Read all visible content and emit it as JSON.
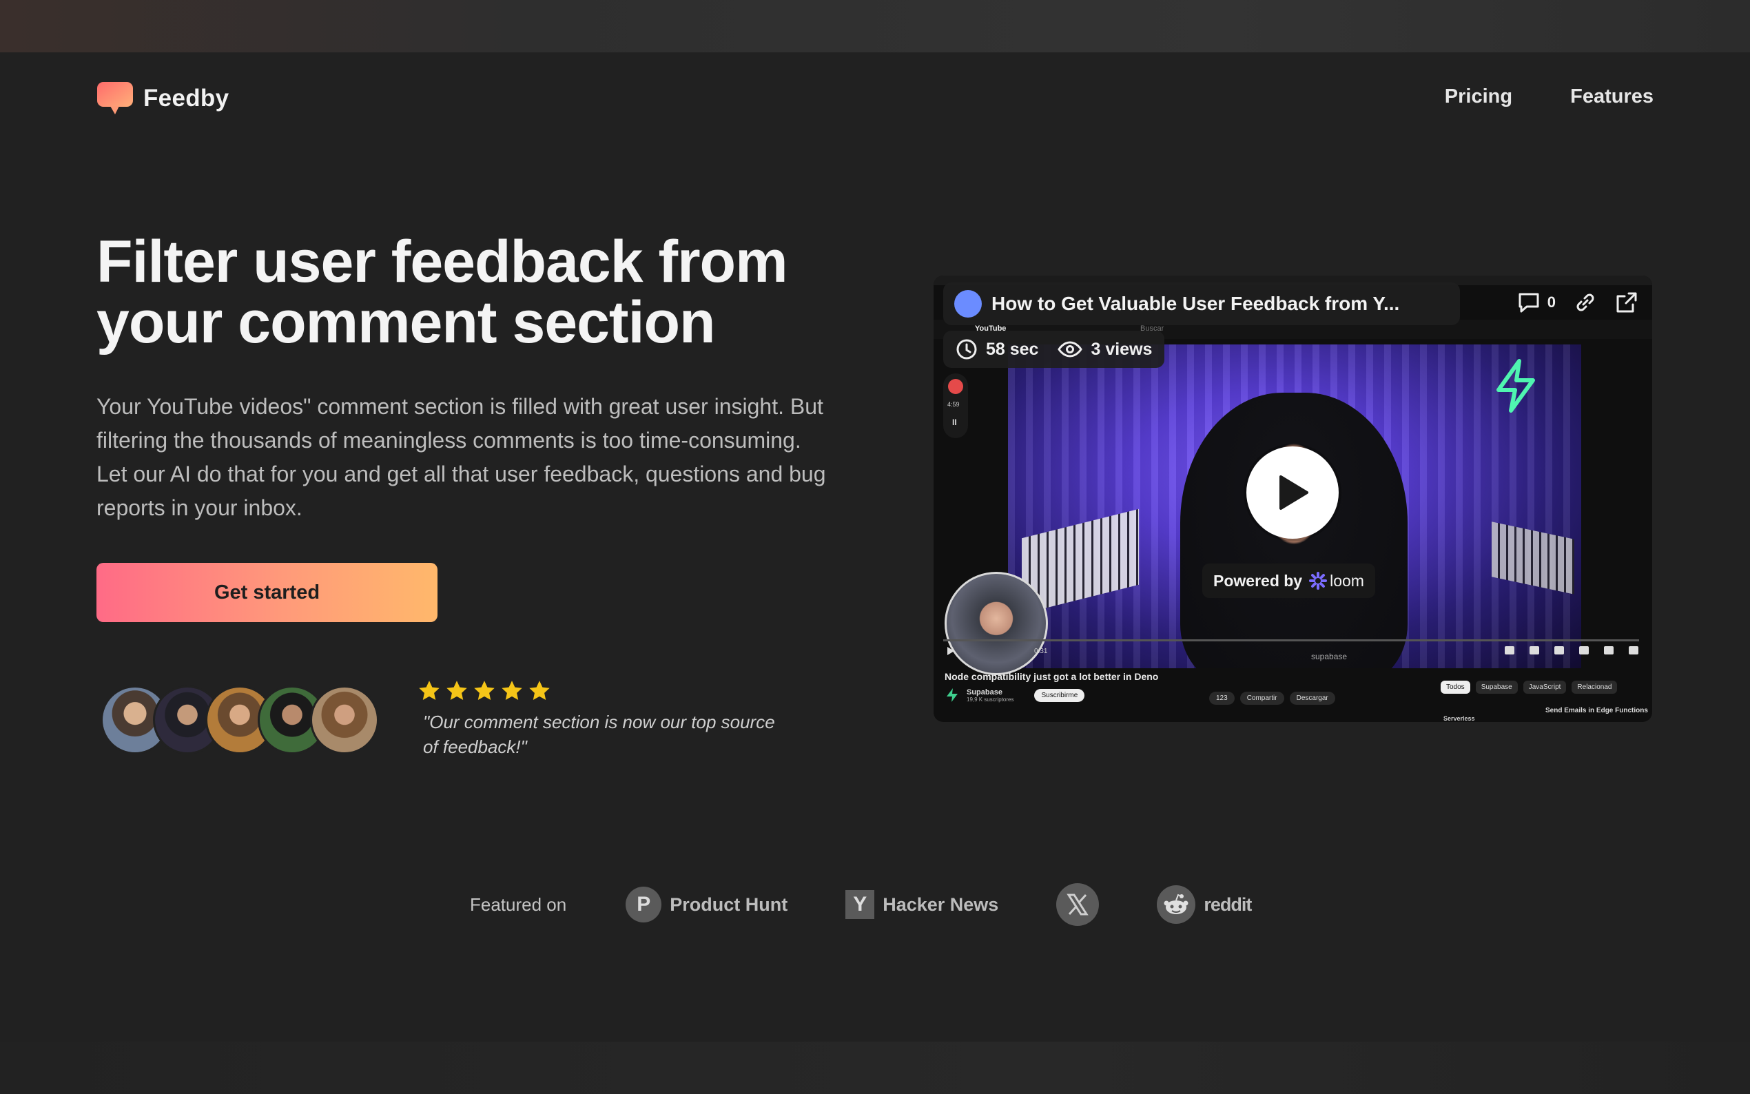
{
  "brand": {
    "name": "Feedby",
    "accent": "#ff8f6b"
  },
  "nav": {
    "items": [
      {
        "label": "Pricing"
      },
      {
        "label": "Features"
      }
    ]
  },
  "hero": {
    "title_line1": "Filter user feedback from",
    "title_line2": "your comment section",
    "description": "Your YouTube videos\" comment section is filled with great user insight. But filtering the thousands of meaningless comments is too time-consuming. Let our AI do that for you and get all that user feedback, questions and bug reports in your inbox.",
    "cta_label": "Get started",
    "cta_gradient": [
      "#ff6b86",
      "#ffb86b"
    ]
  },
  "social_proof": {
    "rating": 5,
    "rating_max": 5,
    "quote": "\"Our comment section is now our top source of feedback!\"",
    "avatar_count": 5
  },
  "video": {
    "title": "How to Get Valuable User Feedback from Y...",
    "comment_count": "0",
    "duration": "58 sec",
    "views": "3 views",
    "powered_by": "Powered by",
    "provider": "loom",
    "rec_time": "4:59",
    "time_label": "0:31",
    "inner": {
      "yt_title": "Node compatibility just got a lot better in Deno",
      "channel": "Supabase",
      "subscribers": "19,9 K suscriptores",
      "subscribe": "Suscribirme",
      "likes": "123",
      "share": "Compartir",
      "download": "Descargar",
      "chips": [
        "Todos",
        "Supabase",
        "JavaScript",
        "Relacionad"
      ],
      "side_item": "Send Emails in Edge Functions",
      "side_label": "Serverless",
      "watermark": "supabase",
      "youtube_label": "YouTube",
      "search_placeholder": "Buscar"
    }
  },
  "featured": {
    "label": "Featured on",
    "items": [
      {
        "name": "Product Hunt",
        "icon": "product-hunt-icon",
        "glyph": "P"
      },
      {
        "name": "Hacker News",
        "icon": "hacker-news-icon",
        "glyph": "Y"
      },
      {
        "name": "",
        "icon": "x-icon"
      },
      {
        "name": "reddit",
        "icon": "reddit-icon"
      }
    ]
  }
}
